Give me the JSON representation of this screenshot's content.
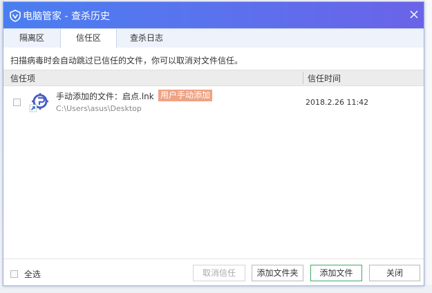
{
  "window": {
    "title": "电脑管家 - 查杀历史"
  },
  "tabs": [
    {
      "label": "隔离区"
    },
    {
      "label": "信任区"
    },
    {
      "label": "查杀日志"
    }
  ],
  "notice": "扫描病毒时会自动跳过已信任的文件，你可以取消对文件信任。",
  "table": {
    "columns": [
      "信任项",
      "信任时间"
    ],
    "rows": [
      {
        "title": "手动添加的文件：启点.lnk",
        "badge": "用户手动添加",
        "path": "C:\\Users\\asus\\Desktop",
        "time": "2018.2.26 11:42"
      }
    ]
  },
  "footer": {
    "select_all": "全选",
    "buttons": {
      "cancel_trust": "取消信任",
      "add_folder": "添加文件夹",
      "add_file": "添加文件",
      "close": "关闭"
    }
  },
  "colors": {
    "title_gradient_start": "#4a7ef0",
    "title_gradient_end": "#6a63e8",
    "badge": "#f0a284",
    "primary_border": "#40a86a"
  },
  "icons": {
    "title": "shield-logo-icon",
    "close": "close-icon",
    "file": "shortcut-app-icon"
  }
}
